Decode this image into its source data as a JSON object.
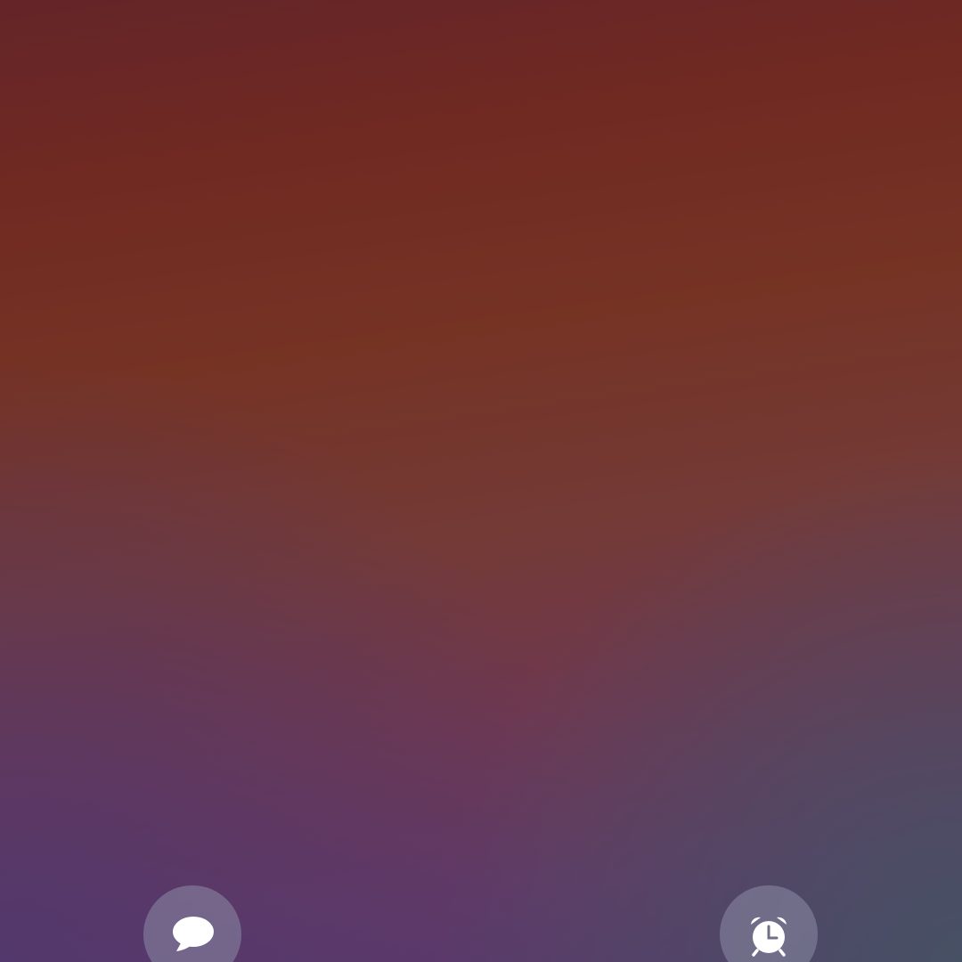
{
  "lockscreen": {
    "shortcuts": [
      {
        "id": "messages",
        "icon": "speech-bubble-icon"
      },
      {
        "id": "alarm",
        "icon": "alarm-clock-icon"
      }
    ]
  },
  "colors": {
    "top": "#642428",
    "middle": "#743a36",
    "bottom_left": "#573a6c",
    "bottom_right": "#4f5263",
    "shortcut_bg": "#8c8ca5",
    "icon": "#ffffff"
  }
}
